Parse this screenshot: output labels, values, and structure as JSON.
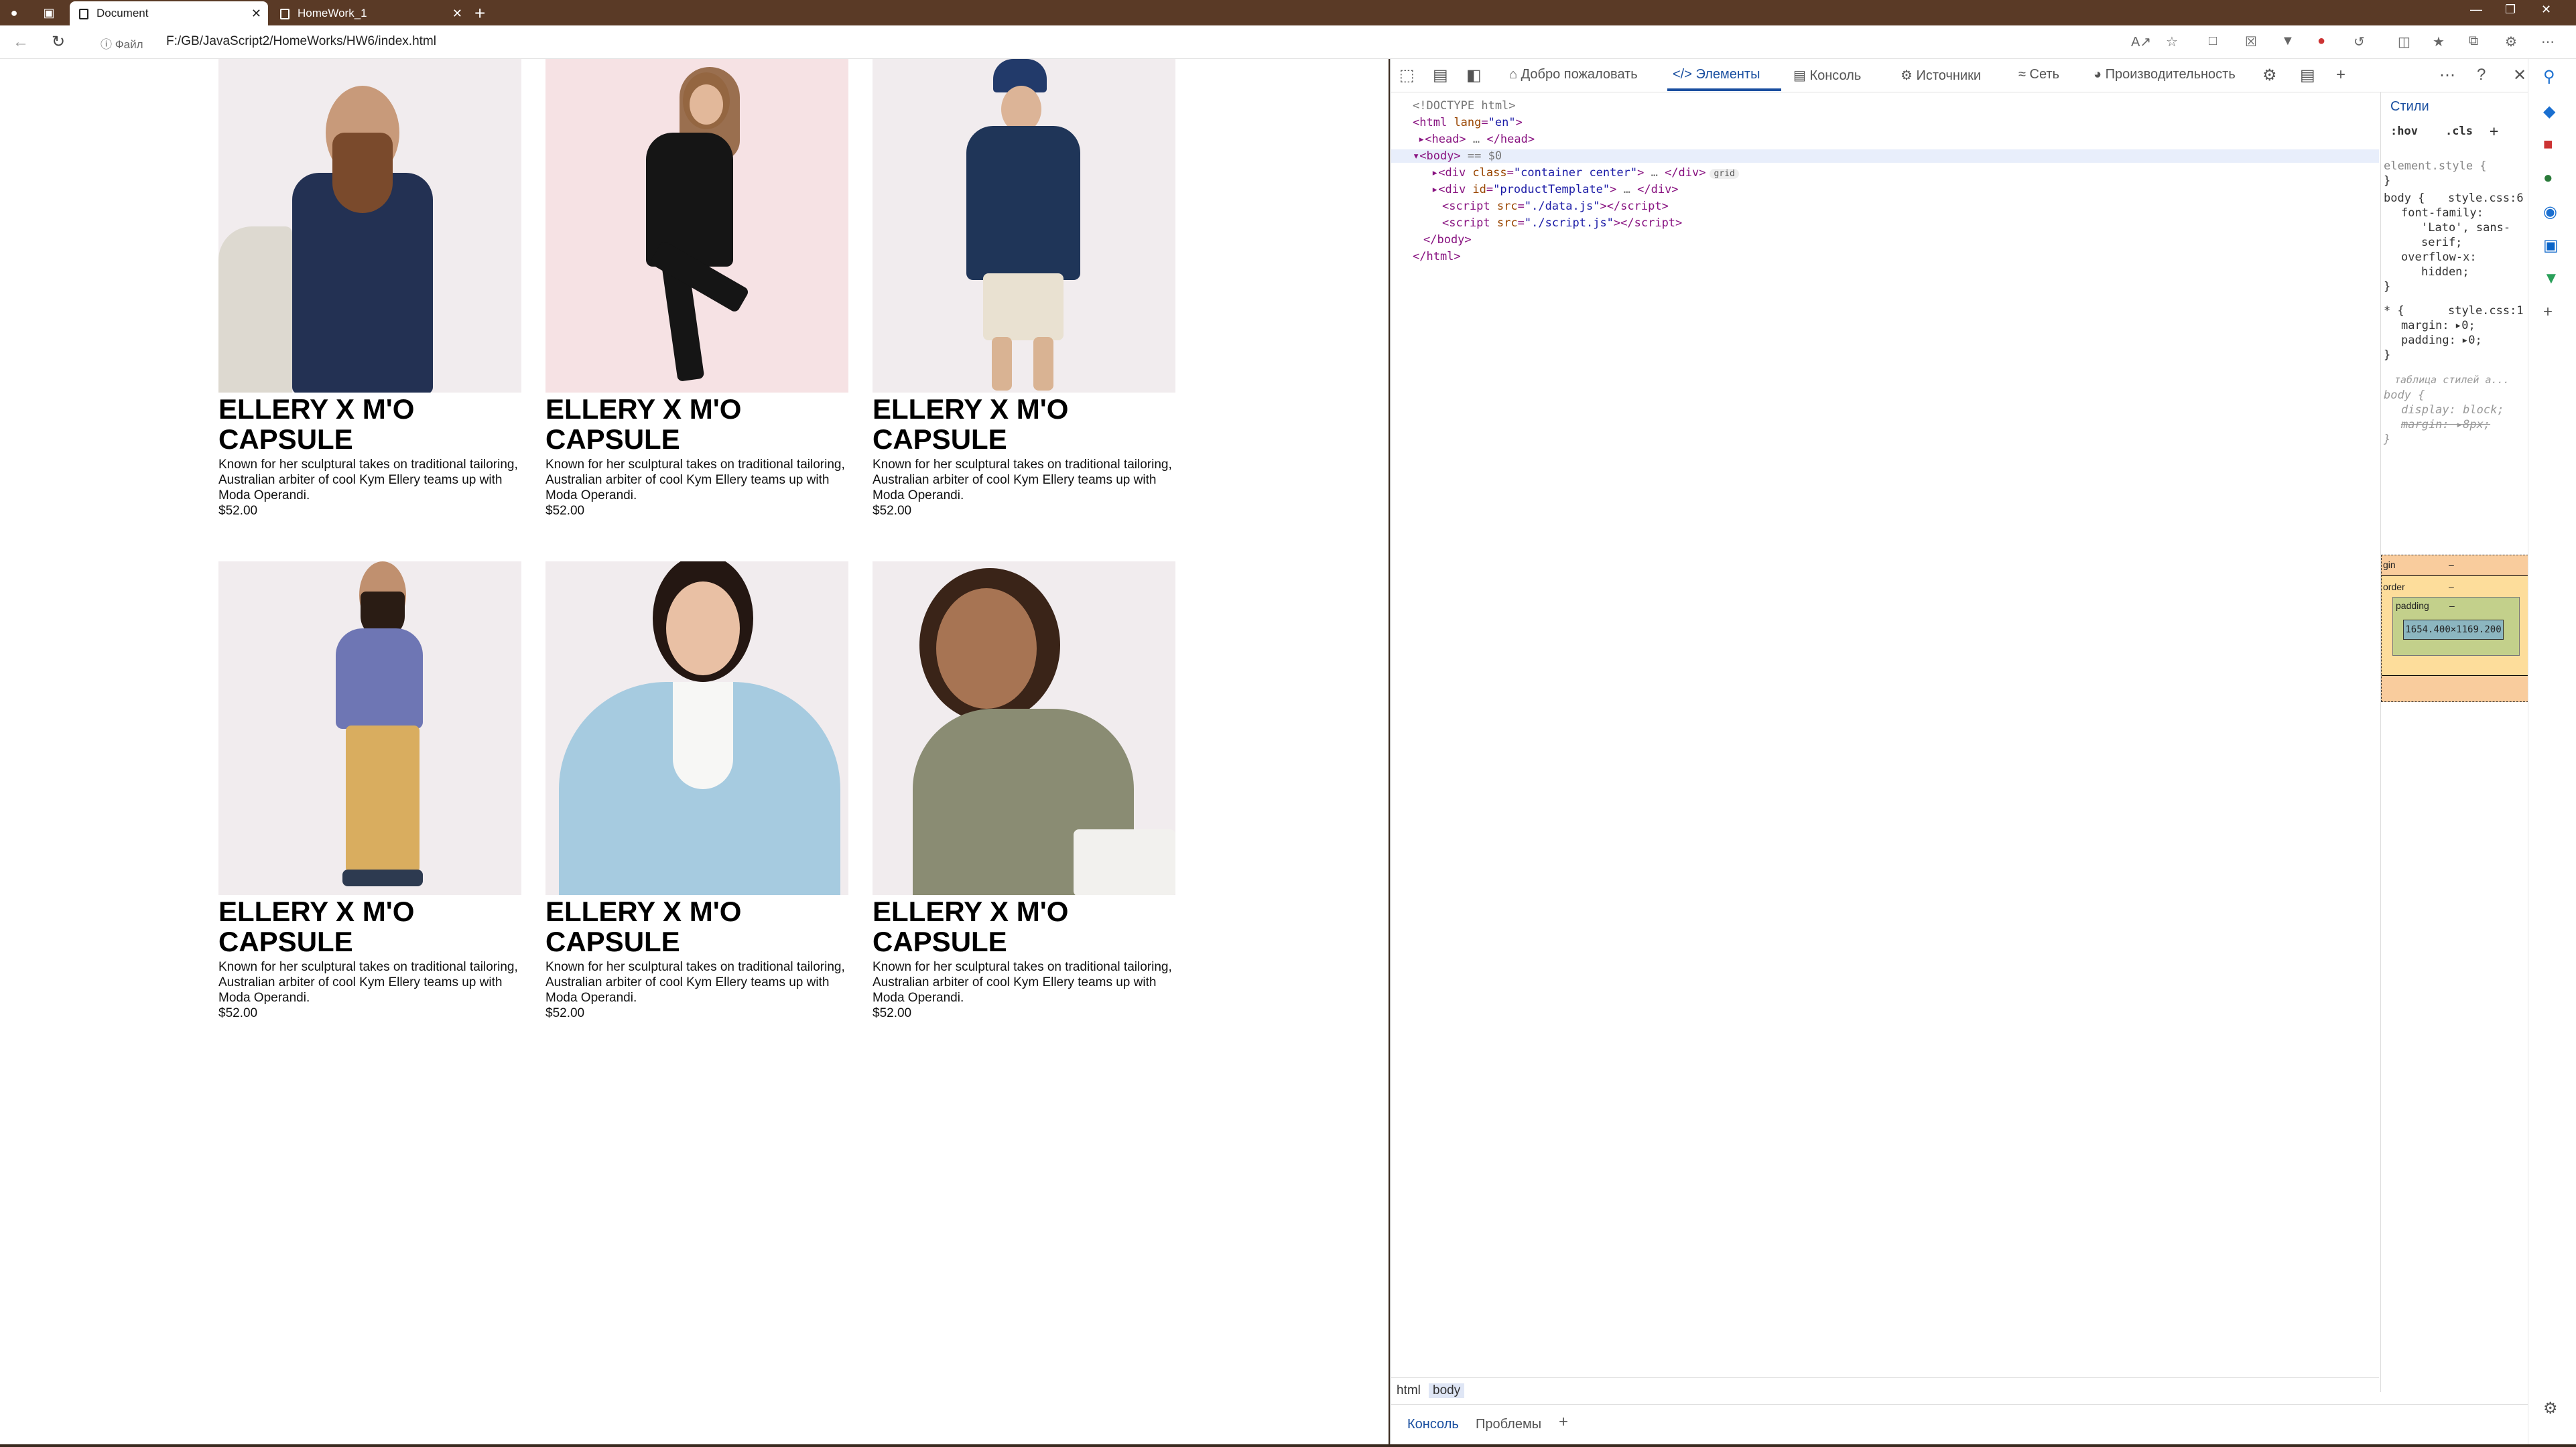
{
  "browser": {
    "tabs": [
      {
        "label": "Document",
        "active": true
      },
      {
        "label": "HomeWork_1",
        "active": false
      }
    ],
    "address": {
      "file_label": "Файл",
      "url": "F:/GB/JavaScript2/HomeWorks/HW6/index.html"
    }
  },
  "products": [
    {
      "title": "ELLERY X M'O CAPSULE",
      "description": "Known for her sculptural takes on traditional tailoring, Australian arbiter of cool Kym Ellery teams up with Moda Operandi.",
      "price": "$52.00"
    },
    {
      "title": "ELLERY X M'O CAPSULE",
      "description": "Known for her sculptural takes on traditional tailoring, Australian arbiter of cool Kym Ellery teams up with Moda Operandi.",
      "price": "$52.00"
    },
    {
      "title": "ELLERY X M'O CAPSULE",
      "description": "Known for her sculptural takes on traditional tailoring, Australian arbiter of cool Kym Ellery teams up with Moda Operandi.",
      "price": "$52.00"
    },
    {
      "title": "ELLERY X M'O CAPSULE",
      "description": "Known for her sculptural takes on traditional tailoring, Australian arbiter of cool Kym Ellery teams up with Moda Operandi.",
      "price": "$52.00"
    },
    {
      "title": "ELLERY X M'O CAPSULE",
      "description": "Known for her sculptural takes on traditional tailoring, Australian arbiter of cool Kym Ellery teams up with Moda Operandi.",
      "price": "$52.00"
    },
    {
      "title": "ELLERY X M'O CAPSULE",
      "description": "Known for her sculptural takes on traditional tailoring, Australian arbiter of cool Kym Ellery teams up with Moda Operandi.",
      "price": "$52.00"
    }
  ],
  "devtools": {
    "tabs": {
      "welcome": "Добро пожаловать",
      "elements": "Элементы",
      "console": "Консоль",
      "sources": "Источники",
      "network": "Сеть",
      "performance": "Производительность"
    },
    "dom": {
      "doctype": "<!DOCTYPE html>",
      "html_open": "<html",
      "lang_attr": "lang",
      "lang_val": "\"en\"",
      "head": "<head>",
      "head_close": "</head>",
      "body_open": "<body>",
      "body_marker": "== $0",
      "div_container_attr": "class",
      "div_container_val": "\"container center\"",
      "grid_badge": "grid",
      "div_template_attr": "id",
      "div_template_val": "\"productTemplate\"",
      "script1_val": "\"./data.js\"",
      "script2_val": "\"./script.js\"",
      "body_close": "</body>",
      "html_close": "</html>",
      "ellipsis": "…"
    },
    "styles": {
      "tab_label": "Стили",
      "hov": ":hov",
      "cls": ".cls",
      "element_style": "element.style {",
      "close_brace": "}",
      "body_selector": "body {",
      "style_link_6": "style.css:6",
      "font_family_prop": "font-family:",
      "font_family_val1": "'Lato', sans-",
      "font_family_val2": "serif;",
      "overflow_prop": "overflow-x:",
      "overflow_val": "hidden;",
      "star_selector": "* {",
      "style_link_1": "style.css:1",
      "margin_prop": "margin:",
      "margin_val": "0;",
      "padding_prop": "padding:",
      "padding_val": "0;",
      "ua_label": "таблица стилей а...",
      "ua_body": "body {",
      "display_prop": "display:",
      "display_val": "block;",
      "ua_margin": "margin:",
      "ua_margin_val": "8px;"
    },
    "box_model": {
      "margin_label": "gin",
      "border_label": "order",
      "padding_label": "padding",
      "content": "1654.400×1169.200",
      "dash": "–"
    },
    "breadcrumb": [
      "html",
      "body"
    ],
    "drawer": {
      "console": "Консоль",
      "issues": "Проблемы"
    }
  }
}
